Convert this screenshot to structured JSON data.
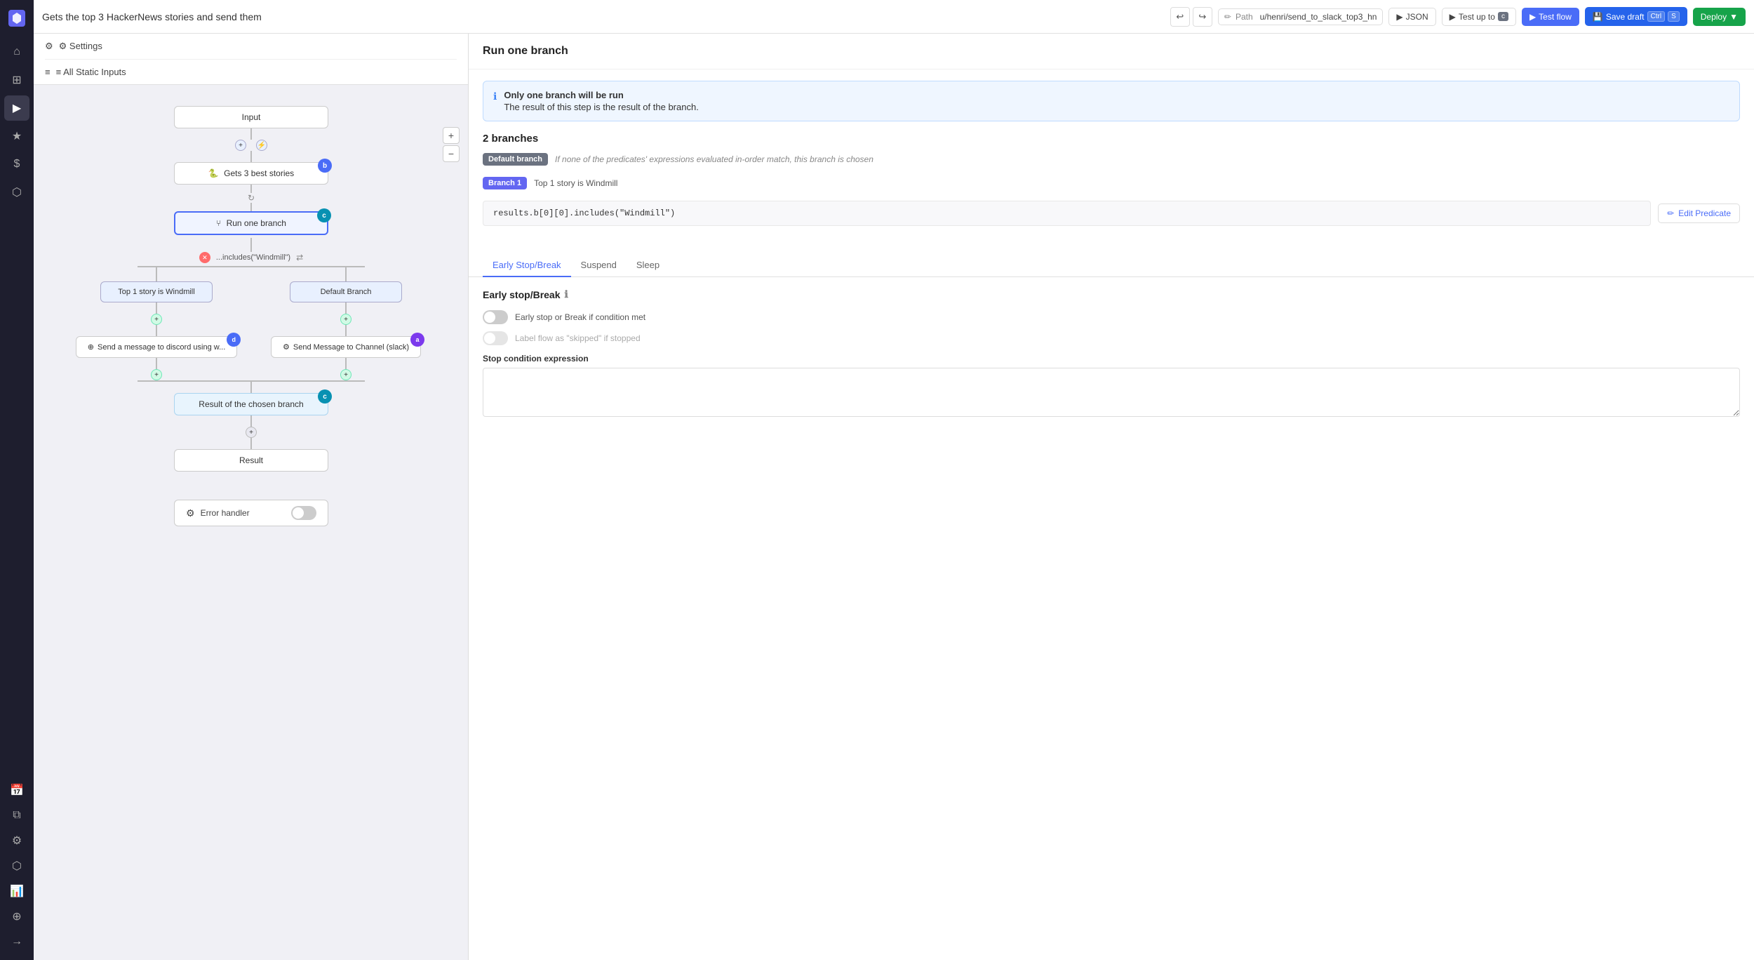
{
  "app": {
    "logo": "W",
    "title": "Gets the top 3 HackerNews stories and send them"
  },
  "topbar": {
    "undo_label": "↩",
    "redo_label": "↪",
    "path_label": "Path",
    "path_value": "u/henri/send_to_slack_top3_hn",
    "json_label": "JSON",
    "test_up_to_label": "Test up to",
    "test_up_to_badge": "c",
    "test_flow_label": "Test flow",
    "save_draft_label": "Save draft",
    "save_kbd": "Ctrl",
    "save_kbd2": "S",
    "deploy_label": "Deploy"
  },
  "sidebar": {
    "settings_label": "⚙ Settings",
    "static_inputs_label": "≡ All Static Inputs"
  },
  "flow": {
    "nodes": [
      {
        "id": "input",
        "label": "Input",
        "type": "input"
      },
      {
        "id": "gets_stories",
        "label": "Gets 3 best stories",
        "type": "python",
        "badge": "b",
        "badge_color": "blue"
      },
      {
        "id": "run_one_branch",
        "label": "Run one branch",
        "type": "branch",
        "badge": "c",
        "badge_color": "teal",
        "selected": true
      },
      {
        "id": "top1_windmill",
        "label": "Top 1 story is Windmill",
        "type": "branch_label"
      },
      {
        "id": "default_branch",
        "label": "Default Branch",
        "type": "branch_label"
      },
      {
        "id": "discord_msg",
        "label": "Send a message to discord using w...",
        "type": "module",
        "badge": "d",
        "badge_color": "blue"
      },
      {
        "id": "slack_msg",
        "label": "Send Message to Channel (slack)",
        "type": "module",
        "badge": "a",
        "badge_color": "purple"
      },
      {
        "id": "result_branch",
        "label": "Result of the chosen branch",
        "type": "result",
        "badge": "c",
        "badge_color": "teal"
      },
      {
        "id": "result",
        "label": "Result",
        "type": "result_final"
      }
    ],
    "predicate_text": "...includes(\"Windmill\")",
    "error_handler_label": "Error handler"
  },
  "right_panel": {
    "title": "Run one branch",
    "info": {
      "line1": "Only one branch will be run",
      "line2": "The result of this step is the result of the branch."
    },
    "branches_count": "2 branches",
    "default_branch": {
      "tag": "Default branch",
      "description": "If none of the predicates' expressions evaluated in-order match, this branch is chosen"
    },
    "branch1": {
      "tag": "Branch 1",
      "predicate_label": "Top 1 story is Windmill",
      "code": "results.b[0][0].includes(\"Windmill\")",
      "edit_btn": "Edit Predicate"
    },
    "tabs": [
      "Early Stop/Break",
      "Suspend",
      "Sleep"
    ],
    "active_tab": "Early Stop/Break",
    "early_stop": {
      "title": "Early stop/Break",
      "toggle1_label": "Early stop or Break if condition met",
      "toggle2_label": "Label flow as \"skipped\" if stopped",
      "condition_label": "Stop condition expression"
    }
  },
  "icons": {
    "path": "✏",
    "json": "▶",
    "test_up_to": "▶",
    "test_flow": "▶",
    "save": "💾",
    "deploy": "🚀",
    "settings": "⚙",
    "inputs": "≡",
    "edit": "✏",
    "info": "ℹ",
    "gear": "⚙",
    "plus": "+",
    "minus": "−"
  }
}
